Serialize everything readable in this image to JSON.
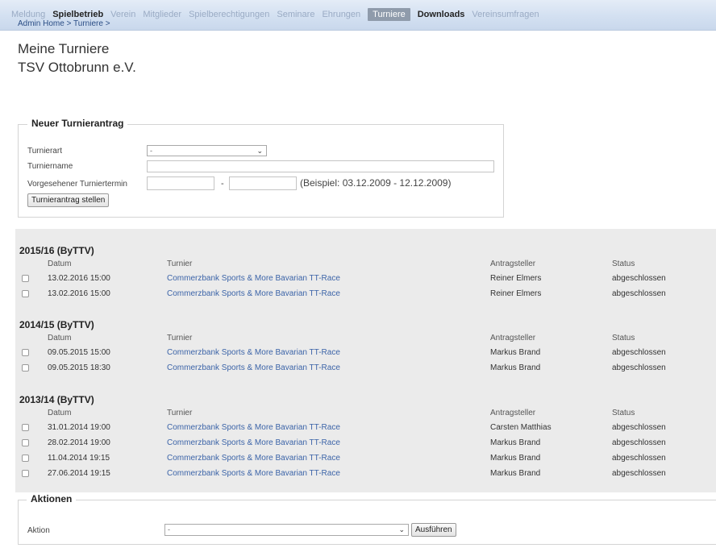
{
  "nav": {
    "items": [
      {
        "label": "Meldung",
        "style": "faded"
      },
      {
        "label": "Spielbetrieb",
        "style": "dark"
      },
      {
        "label": "Verein",
        "style": "faded"
      },
      {
        "label": "Mitglieder",
        "style": "faded"
      },
      {
        "label": "Spielberechtigungen",
        "style": "faded"
      },
      {
        "label": "Seminare",
        "style": "faded"
      },
      {
        "label": "Ehrungen",
        "style": "faded"
      },
      {
        "label": "Turniere",
        "style": "active"
      },
      {
        "label": "Downloads",
        "style": "dark"
      },
      {
        "label": "Vereinsumfragen",
        "style": "faded"
      }
    ],
    "breadcrumb": [
      "Admin Home",
      ">",
      "Turniere",
      ">"
    ]
  },
  "page": {
    "title": "Meine Turniere",
    "club": "TSV Ottobrunn e.V."
  },
  "new_request": {
    "legend": "Neuer Turnierantrag",
    "type_label": "Turnierart",
    "type_value": "-",
    "name_label": "Turniername",
    "name_value": "",
    "date_label": "Vorgesehener Turniertermin",
    "date_from": "",
    "date_separator": "-",
    "date_to": "",
    "date_hint": "(Beispiel: 03.12.2009 - 12.12.2009)",
    "submit_label": "Turnierantrag stellen"
  },
  "columns": {
    "date": "Datum",
    "tournament": "Turnier",
    "applicant": "Antragsteller",
    "status": "Status"
  },
  "seasons": [
    {
      "name": "2015/16 (ByTTV)",
      "rows": [
        {
          "date": "13.02.2016 15:00",
          "tournament": "Commerzbank Sports & More Bavarian TT-Race",
          "applicant": "Reiner Elmers",
          "status": "abgeschlossen"
        },
        {
          "date": "13.02.2016 15:00",
          "tournament": "Commerzbank Sports & More Bavarian TT-Race",
          "applicant": "Reiner Elmers",
          "status": "abgeschlossen"
        }
      ]
    },
    {
      "name": "2014/15 (ByTTV)",
      "rows": [
        {
          "date": "09.05.2015 15:00",
          "tournament": "Commerzbank Sports & More Bavarian TT-Race",
          "applicant": "Markus Brand",
          "status": "abgeschlossen"
        },
        {
          "date": "09.05.2015 18:30",
          "tournament": "Commerzbank Sports & More Bavarian TT-Race",
          "applicant": "Markus Brand",
          "status": "abgeschlossen"
        }
      ]
    },
    {
      "name": "2013/14 (ByTTV)",
      "rows": [
        {
          "date": "31.01.2014 19:00",
          "tournament": "Commerzbank Sports & More Bavarian TT-Race",
          "applicant": "Carsten Matthias",
          "status": "abgeschlossen"
        },
        {
          "date": "28.02.2014 19:00",
          "tournament": "Commerzbank Sports & More Bavarian TT-Race",
          "applicant": "Markus Brand",
          "status": "abgeschlossen"
        },
        {
          "date": "11.04.2014 19:15",
          "tournament": "Commerzbank Sports & More Bavarian TT-Race",
          "applicant": "Markus Brand",
          "status": "abgeschlossen"
        },
        {
          "date": "27.06.2014 19:15",
          "tournament": "Commerzbank Sports & More Bavarian TT-Race",
          "applicant": "Markus Brand",
          "status": "abgeschlossen"
        }
      ]
    }
  ],
  "actions": {
    "legend": "Aktionen",
    "action_label": "Aktion",
    "action_value": "-",
    "execute_label": "Ausführen"
  },
  "icons": {
    "dropdown": "chevron-down-icon"
  }
}
